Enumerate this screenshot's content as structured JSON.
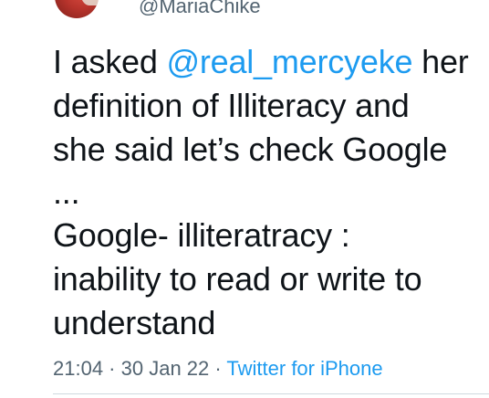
{
  "author": {
    "handle": "@MariaChike"
  },
  "tweet": {
    "line1_prefix": "I asked ",
    "mention": "@real_mercyeke",
    "line1_suffix": " her",
    "line2": "definition of Illiteracy and",
    "line3": "she said let’s check Google",
    "line4": "...",
    "line5": "Google- illiteratracy :",
    "line6": "inability to read or write to",
    "line7": "understand"
  },
  "meta": {
    "time": "21:04",
    "separator1": " · ",
    "date": "30 Jan 22",
    "separator2": " · ",
    "source": "Twitter for iPhone"
  },
  "colors": {
    "text": "#0f1419",
    "secondary": "#536471",
    "link": "#1d9bf0"
  }
}
